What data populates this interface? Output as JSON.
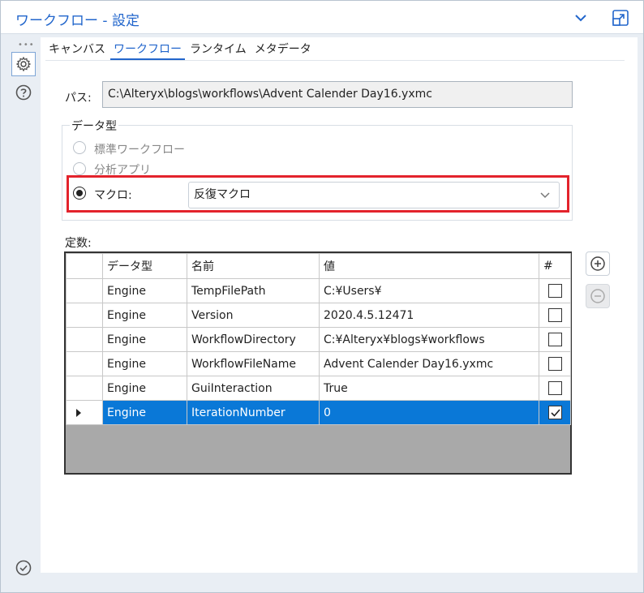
{
  "window": {
    "title": "ワークフロー - 設定"
  },
  "icons": {
    "collapse": "chevron-down-icon",
    "undock": "undock-icon",
    "settings": "gear-icon",
    "help": "help-icon",
    "status": "check-circle-icon",
    "add": "plus-circle-icon",
    "remove": "minus-circle-icon"
  },
  "colors": {
    "accent": "#2266cc",
    "selection": "#0a78d7",
    "highlight_box": "#e3232c"
  },
  "tabs": [
    {
      "label": "キャンバス",
      "active": false
    },
    {
      "label": "ワークフロー",
      "active": true
    },
    {
      "label": "ランタイム",
      "active": false
    },
    {
      "label": "メタデータ",
      "active": false
    }
  ],
  "path": {
    "label": "パス:",
    "value": "C:\\Alteryx\\blogs\\workflows\\Advent Calender Day16.yxmc"
  },
  "data_type": {
    "label": "データ型",
    "options": [
      {
        "label": "標準ワークフロー",
        "selected": false
      },
      {
        "label": "分析アプリ",
        "selected": false
      },
      {
        "label": "マクロ:",
        "selected": true
      }
    ],
    "macro_type": "反復マクロ"
  },
  "constants": {
    "label": "定数:",
    "columns": [
      "データ型",
      "名前",
      "値",
      "#"
    ],
    "rows": [
      {
        "type": "Engine",
        "name": "TempFilePath",
        "value": "C:¥Users¥",
        "checked": false
      },
      {
        "type": "Engine",
        "name": "Version",
        "value": "2020.4.5.12471",
        "checked": false
      },
      {
        "type": "Engine",
        "name": "WorkflowDirectory",
        "value": "C:¥Alteryx¥blogs¥workflows",
        "checked": false
      },
      {
        "type": "Engine",
        "name": "WorkflowFileName",
        "value": "Advent Calender Day16.yxmc",
        "checked": false
      },
      {
        "type": "Engine",
        "name": "GuiInteraction",
        "value": "True",
        "checked": false
      },
      {
        "type": "Engine",
        "name": "IterationNumber",
        "value": "0",
        "checked": true,
        "selected": true
      }
    ]
  }
}
